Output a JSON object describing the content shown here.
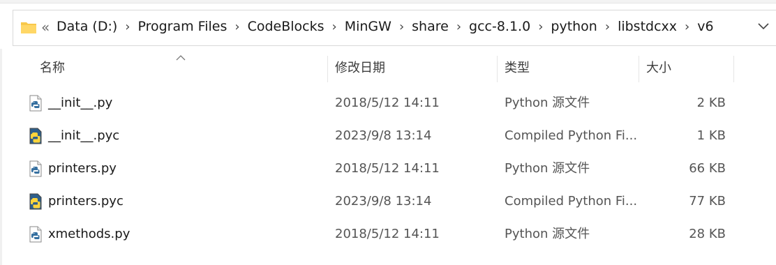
{
  "breadcrumb": {
    "overflow": "«",
    "items": [
      "Data (D:)",
      "Program Files",
      "CodeBlocks",
      "MinGW",
      "share",
      "gcc-8.1.0",
      "python",
      "libstdcxx",
      "v6"
    ],
    "separator": "›"
  },
  "columns": {
    "name": "名称",
    "date": "修改日期",
    "type": "类型",
    "size": "大小"
  },
  "files": [
    {
      "name": "__init__.py",
      "date": "2018/5/12 14:11",
      "type": "Python 源文件",
      "size": "2 KB",
      "icon": "python-file-icon"
    },
    {
      "name": "__init__.pyc",
      "date": "2023/9/8 13:14",
      "type": "Compiled Python Fi...",
      "size": "1 KB",
      "icon": "compiled-python-file-icon"
    },
    {
      "name": "printers.py",
      "date": "2018/5/12 14:11",
      "type": "Python 源文件",
      "size": "66 KB",
      "icon": "python-file-icon"
    },
    {
      "name": "printers.pyc",
      "date": "2023/9/8 13:14",
      "type": "Compiled Python Fi...",
      "size": "77 KB",
      "icon": "compiled-python-file-icon"
    },
    {
      "name": "xmethods.py",
      "date": "2018/5/12 14:11",
      "type": "Python 源文件",
      "size": "28 KB",
      "icon": "python-file-icon"
    }
  ],
  "colors": {
    "folder": "#f8c84a",
    "python_blue": "#3670a0",
    "python_yellow": "#ffd43b"
  }
}
